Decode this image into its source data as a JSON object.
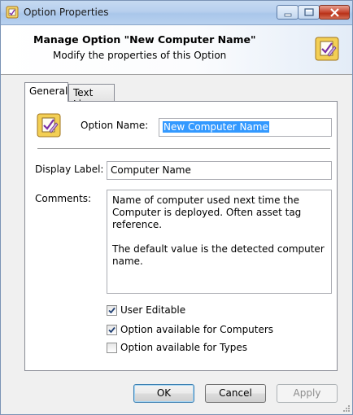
{
  "window": {
    "title": "Option Properties",
    "app_icon": "option-properties-icon"
  },
  "header": {
    "title": "Manage Option \"New Computer Name\"",
    "subtitle": "Modify the properties of this Option",
    "icon": "option-edit-icon"
  },
  "tabs": [
    {
      "label": "General",
      "active": true
    },
    {
      "label": "Text Line",
      "active": false
    }
  ],
  "form": {
    "option_name_label": "Option Name:",
    "option_name_value": "New Computer Name",
    "display_label_label": "Display Label:",
    "display_label_value": "Computer Name",
    "comments_label": "Comments:",
    "comments_value": "Name of computer used next time the Computer is deployed. Often asset tag reference.\n\nThe default value is the detected computer name.",
    "checkboxes": [
      {
        "label": "User Editable",
        "checked": true
      },
      {
        "label": "Option available for Computers",
        "checked": true
      },
      {
        "label": "Option available for Types",
        "checked": false
      }
    ]
  },
  "buttons": {
    "ok": "OK",
    "cancel": "Cancel",
    "apply": "Apply",
    "apply_enabled": false
  },
  "colors": {
    "selection": "#3399ff",
    "titlebar": "#b9d1ee",
    "close_button": "#c7452f"
  }
}
